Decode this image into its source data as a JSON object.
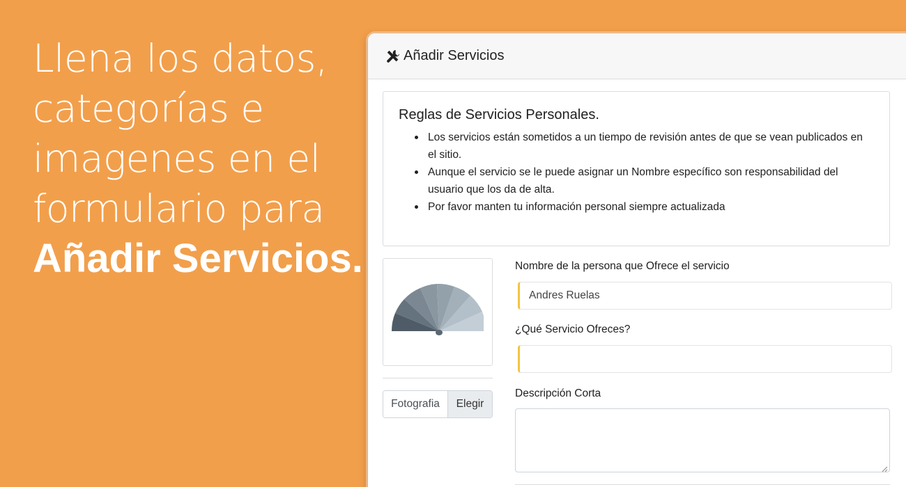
{
  "hero": {
    "line1": "Llena los datos,",
    "line2": "categorías e",
    "line3": "imagenes en el",
    "line4": "formulario para",
    "line5": "Añadir Servicios."
  },
  "window": {
    "title": "Añadir Servicios",
    "title_icon": "tools-icon"
  },
  "rules": {
    "title": "Reglas de Servicios Personales.",
    "items": [
      "Los servicios están sometidos a un tiempo de revisión antes de que se vean publicados en el sitio.",
      "Aunque el servicio se le puede asignar un Nombre específico son responsabilidad del usuario que los da de alta.",
      "Por favor manten tu información personal siempre actualizada"
    ]
  },
  "photo": {
    "icon": "image-placeholder-icon",
    "file_label": "Fotografia",
    "choose_button": "Elegir"
  },
  "form": {
    "name_label": "Nombre de la persona que Ofrece el servicio",
    "name_value": "Andres Ruelas",
    "service_label": "¿Qué Servicio Ofreces?",
    "service_value": "",
    "description_label": "Descripción Corta",
    "description_value": ""
  },
  "colors": {
    "background": "#f29f4b",
    "field_accent": "#f3c442"
  }
}
